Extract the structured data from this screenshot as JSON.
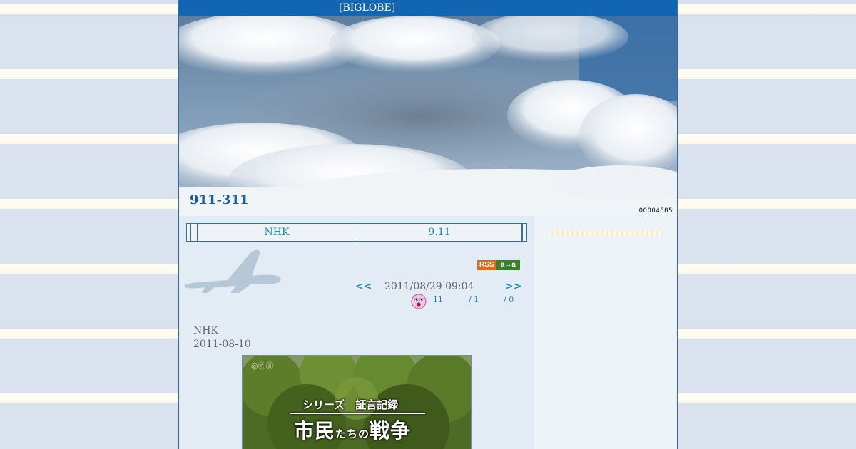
{
  "header": {
    "title": "[BIGLOBE]"
  },
  "banner": {
    "blog_title": "911-311"
  },
  "counter": {
    "value": "00004685"
  },
  "nav": {
    "left": "NHK",
    "right": "9.11"
  },
  "rss": {
    "label1": "RSS",
    "label2": "a→a"
  },
  "entry": {
    "prev": "<<",
    "next": ">>",
    "datetime": "2011/08/29 09:04",
    "stat1": "11",
    "stat2": "/ 1",
    "stat3": "/ 0",
    "line1": "NHK",
    "line2": "2011-08-10",
    "image": {
      "logo": "◎ⓝⓖ",
      "series": "シリーズ　証言記録",
      "main_a": "市民",
      "main_small": "たちの",
      "main_b": "戦争"
    }
  },
  "icons": {
    "face": "surprised-face-icon",
    "plane": "airplane-icon"
  },
  "colors": {
    "topbar": "#1265b0",
    "link": "#1a8aa8",
    "title": "#1c5a91"
  }
}
